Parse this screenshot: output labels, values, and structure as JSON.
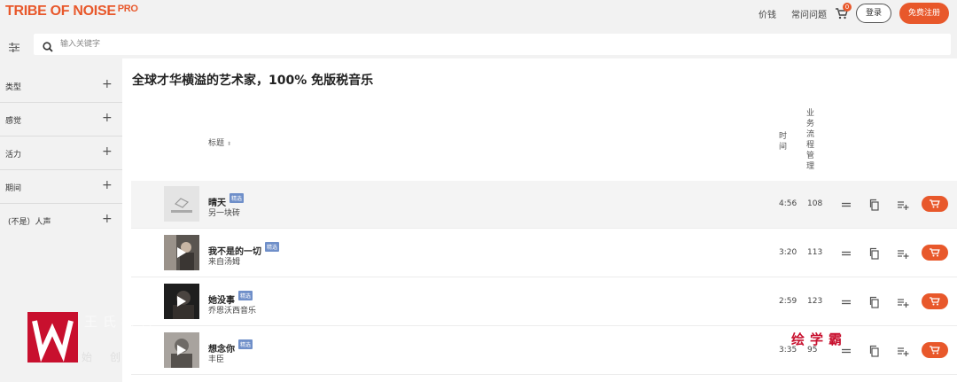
{
  "header": {
    "logo": "TRIBE OF NOISE",
    "logo_pro": "PRO",
    "nav": {
      "price": "价钱",
      "faq": "常问问题"
    },
    "cart_count": "0",
    "login": "登录",
    "signup": "免费注册"
  },
  "search": {
    "placeholder": "输入关键字",
    "value": ""
  },
  "sidebar": {
    "items": [
      {
        "label": "类型",
        "icon": "plus-icon"
      },
      {
        "label": "感觉",
        "icon": "plus-icon"
      },
      {
        "label": "活力",
        "icon": "plus-icon"
      },
      {
        "label": "期间",
        "icon": "plus-icon"
      },
      {
        "label": "(不是）人声",
        "icon": "plus-icon"
      }
    ]
  },
  "main": {
    "title": "全球才华横溢的艺术家，100% 免版税音乐",
    "columns": {
      "title": "标题",
      "time": "时间",
      "workflow": "业务流程管理"
    },
    "tracks": [
      {
        "name": "晴天",
        "tag": "精选",
        "artist": "另一块砖",
        "time": "4:56",
        "count": "108"
      },
      {
        "name": "我不是的一切",
        "tag": "精选",
        "artist": "来自汤姆",
        "time": "3:20",
        "count": "113"
      },
      {
        "name": "她没事",
        "tag": "精选",
        "artist": "乔恩沃西音乐",
        "time": "2:59",
        "count": "123"
      },
      {
        "name": "想念你",
        "tag": "精选",
        "artist": "丰臣",
        "time": "3:35",
        "count": "95"
      }
    ]
  },
  "watermark": {
    "left": "王氏教育",
    "sub": "始创",
    "right": "绘学霸"
  },
  "colors": {
    "accent": "#e8582b",
    "tag": "#6f8fc9",
    "watermark": "#c8102e"
  }
}
